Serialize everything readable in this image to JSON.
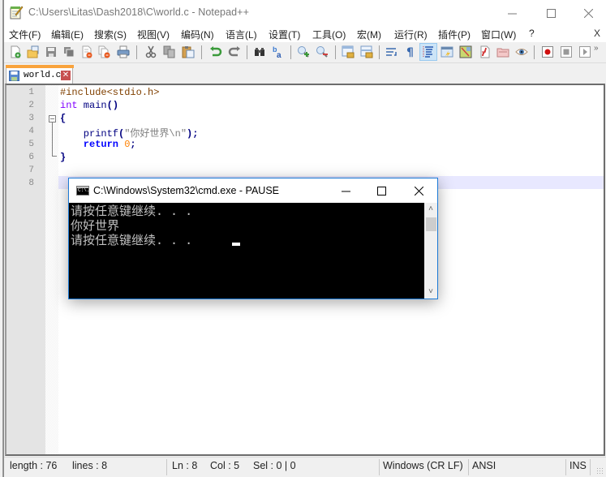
{
  "window": {
    "title": "C:\\Users\\Litas\\Dash2018\\C\\world.c - Notepad++",
    "controls": {
      "minimize": "—",
      "maximize": "☐",
      "close": "✕"
    }
  },
  "menu": {
    "items": [
      {
        "label": "文件(F)"
      },
      {
        "label": "编辑(E)"
      },
      {
        "label": "搜索(S)"
      },
      {
        "label": "视图(V)"
      },
      {
        "label": "编码(N)"
      },
      {
        "label": "语言(L)"
      },
      {
        "label": "设置(T)"
      },
      {
        "label": "工具(O)"
      },
      {
        "label": "宏(M)"
      },
      {
        "label": "运行(R)"
      },
      {
        "label": "插件(P)"
      },
      {
        "label": "窗口(W)"
      },
      {
        "label": "?"
      }
    ],
    "close_doc": "X"
  },
  "toolbar": {
    "buttons": [
      {
        "icon": "new-file-icon"
      },
      {
        "icon": "open-file-icon"
      },
      {
        "icon": "save-icon"
      },
      {
        "icon": "save-all-icon"
      },
      {
        "icon": "close-icon"
      },
      {
        "icon": "close-all-icon"
      },
      {
        "icon": "print-icon"
      },
      {
        "icon": "cut-icon"
      },
      {
        "icon": "copy-icon"
      },
      {
        "icon": "paste-icon"
      },
      {
        "icon": "undo-icon"
      },
      {
        "icon": "redo-icon"
      },
      {
        "icon": "find-icon"
      },
      {
        "icon": "replace-icon"
      },
      {
        "icon": "zoom-in-icon"
      },
      {
        "icon": "zoom-out-icon"
      },
      {
        "icon": "sync-vertical-icon"
      },
      {
        "icon": "sync-horizontal-icon"
      },
      {
        "icon": "word-wrap-icon"
      },
      {
        "icon": "show-all-chars-icon"
      },
      {
        "icon": "indent-guide-icon",
        "active": true
      },
      {
        "icon": "udl-icon"
      },
      {
        "icon": "doc-map-icon"
      },
      {
        "icon": "function-list-icon"
      },
      {
        "icon": "folder-workspace-icon"
      },
      {
        "icon": "monitoring-icon"
      },
      {
        "icon": "record-macro-icon"
      },
      {
        "icon": "stop-macro-icon"
      },
      {
        "icon": "play-macro-icon"
      }
    ],
    "more": "»"
  },
  "tabs": [
    {
      "label": "world.c",
      "close": "✕",
      "active": true
    }
  ],
  "editor": {
    "line_numbers": [
      "1",
      "2",
      "3",
      "4",
      "5",
      "6",
      "7",
      "8"
    ],
    "lines": [
      [
        {
          "t": "#include<stdio.h>",
          "c": "pre"
        }
      ],
      [
        {
          "t": "int",
          "c": "kw"
        },
        {
          "t": " main",
          "c": "fn"
        },
        {
          "t": "()",
          "c": "op"
        }
      ],
      [
        {
          "t": "{",
          "c": "op"
        }
      ],
      [
        {
          "t": "    printf",
          "c": "fn"
        },
        {
          "t": "(",
          "c": "op"
        },
        {
          "t": "\"你好世界\\n\"",
          "c": "str"
        },
        {
          "t": ");",
          "c": "op"
        }
      ],
      [
        {
          "t": "    return",
          "c": "ret"
        },
        {
          "t": " ",
          "c": "fn"
        },
        {
          "t": "0",
          "c": "num"
        },
        {
          "t": ";",
          "c": "op"
        }
      ],
      [
        {
          "t": "}",
          "c": "op"
        }
      ],
      [],
      []
    ],
    "current_line": 8
  },
  "status": {
    "length": "length : 76",
    "lines": "lines : 8",
    "ln": "Ln : 8",
    "col": "Col : 5",
    "sel": "Sel : 0 | 0",
    "eol": "Windows (CR LF)",
    "encoding": "ANSI",
    "mode": "INS"
  },
  "cmd": {
    "title": "C:\\Windows\\System32\\cmd.exe - PAUSE",
    "icon_text": "C:\\.",
    "output": [
      "请按任意键继续. . .",
      "你好世界",
      "请按任意键继续. . ."
    ],
    "controls": {
      "minimize": "—",
      "maximize": "☐",
      "close": "✕"
    },
    "scroll_up": "˄",
    "scroll_down": "˅"
  },
  "colors": {
    "tab_accent": "#f9a33c",
    "current_line_bg": "#e8e8ff",
    "cmd_border": "#1c7ad6",
    "preprocessor": "#804000",
    "keyword": "#8000ff",
    "string": "#808080",
    "return_keyword": "#0000ff",
    "number": "#ff8000"
  }
}
